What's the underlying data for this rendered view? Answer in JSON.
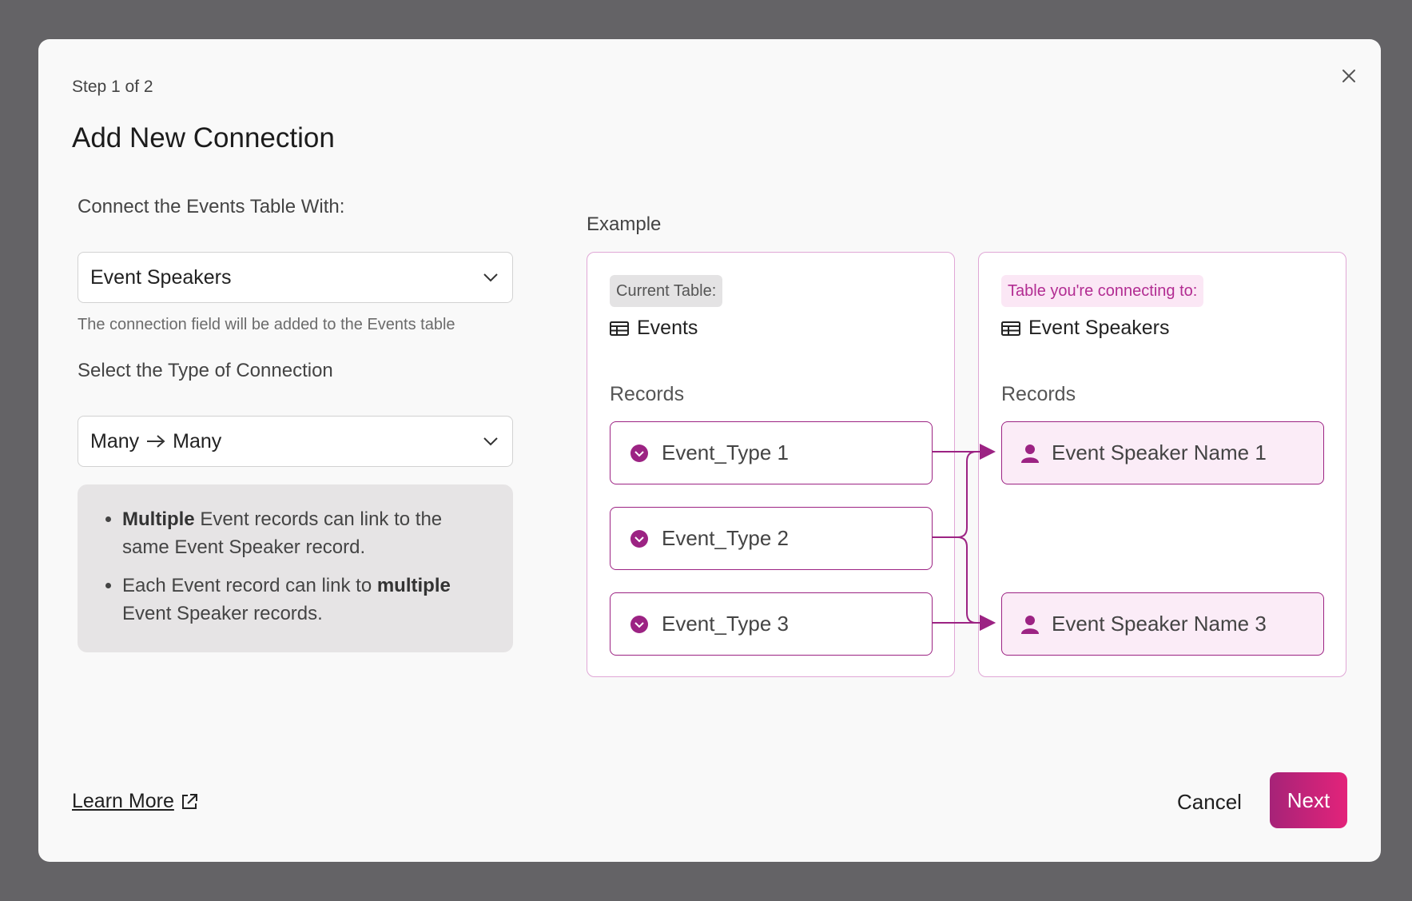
{
  "header": {
    "step": "Step 1 of 2",
    "title": "Add New Connection"
  },
  "form": {
    "table_label": "Connect the Events Table With:",
    "table_value": "Event Speakers",
    "helper": "The connection field will be added to the Events table",
    "type_label": "Select the Type of Connection",
    "type_left": "Many",
    "type_right": "Many"
  },
  "info": {
    "bullet1_bold": "Multiple",
    "bullet1_rest": " Event records can link to the same Event Speaker record.",
    "bullet2_start": "Each Event record can link to ",
    "bullet2_bold": "multiple",
    "bullet2_end": " Event Speaker records."
  },
  "example": {
    "label": "Example",
    "current": {
      "pill": "Current Table:",
      "table": "Events",
      "records_label": "Records",
      "records": [
        "Event_Type 1",
        "Event_Type 2",
        "Event_Type 3"
      ]
    },
    "target": {
      "pill": "Table you're connecting to:",
      "table": "Event Speakers",
      "records_label": "Records",
      "records": [
        "Event Speaker Name 1",
        "Event Speaker Name 3"
      ]
    }
  },
  "footer": {
    "learn_more": "Learn More",
    "cancel": "Cancel",
    "next": "Next"
  },
  "colors": {
    "accent": "#9c2383",
    "next_start": "#a62378",
    "next_end": "#e3237a",
    "pill_pink_bg": "#fbe7f5"
  }
}
